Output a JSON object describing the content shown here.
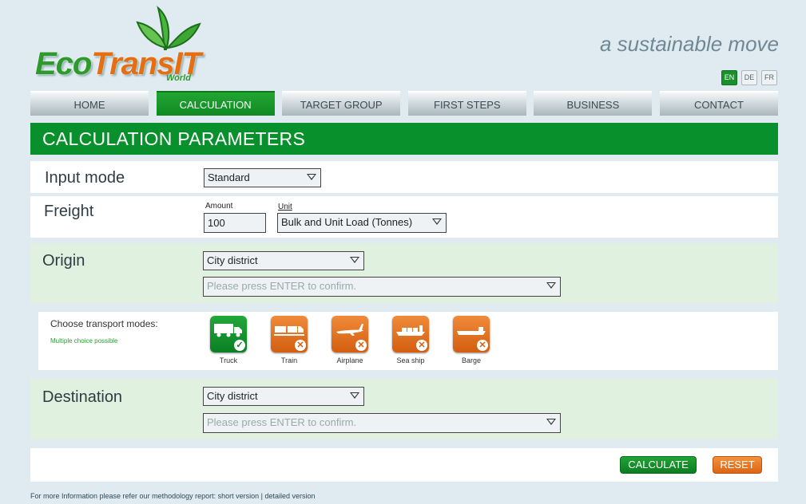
{
  "brand": {
    "logo_main_eco": "Eco",
    "logo_main_trans": "TransIT",
    "logo_sub": "World",
    "tagline": "a sustainable move"
  },
  "languages": [
    {
      "code": "EN",
      "active": true
    },
    {
      "code": "DE",
      "active": false
    },
    {
      "code": "FR",
      "active": false
    }
  ],
  "nav": [
    {
      "label": "HOME",
      "active": false
    },
    {
      "label": "CALCULATION",
      "active": true
    },
    {
      "label": "TARGET GROUP",
      "active": false
    },
    {
      "label": "FIRST STEPS",
      "active": false
    },
    {
      "label": "BUSINESS",
      "active": false
    },
    {
      "label": "CONTACT",
      "active": false
    }
  ],
  "page_title": "CALCULATION PARAMETERS",
  "input_mode": {
    "label": "Input mode",
    "value": "Standard"
  },
  "freight": {
    "label": "Freight",
    "amount_label": "Amount",
    "amount_value": "100",
    "unit_label": "Unit",
    "unit_value": "Bulk and Unit Load (Tonnes)"
  },
  "origin": {
    "label": "Origin",
    "type_value": "City district",
    "location_placeholder": "Please press ENTER to confirm."
  },
  "transport": {
    "label": "Choose transport modes:",
    "hint": "Multiple choice possible",
    "modes": [
      {
        "label": "Truck",
        "icon": "truck-icon",
        "selected": true,
        "mark": "✓"
      },
      {
        "label": "Train",
        "icon": "train-icon",
        "selected": false,
        "mark": "✕"
      },
      {
        "label": "Airplane",
        "icon": "airplane-icon",
        "selected": false,
        "mark": "✕"
      },
      {
        "label": "Sea ship",
        "icon": "sea-ship-icon",
        "selected": false,
        "mark": "✕"
      },
      {
        "label": "Barge",
        "icon": "barge-icon",
        "selected": false,
        "mark": "✕"
      }
    ]
  },
  "destination": {
    "label": "Destination",
    "type_value": "City district",
    "location_placeholder": "Please press ENTER to confirm."
  },
  "actions": {
    "calculate": "CALCULATE",
    "reset": "RESET"
  },
  "footer": {
    "text": "For more Information please refer our methodology report: ",
    "short_link": "short version",
    "separator": " | ",
    "detailed_link": "detailed version"
  },
  "colors": {
    "brand_green": "#08902c",
    "accent_orange": "#db6515",
    "page_bg": "#dfeaf1",
    "panel_green": "#e1f1df"
  }
}
